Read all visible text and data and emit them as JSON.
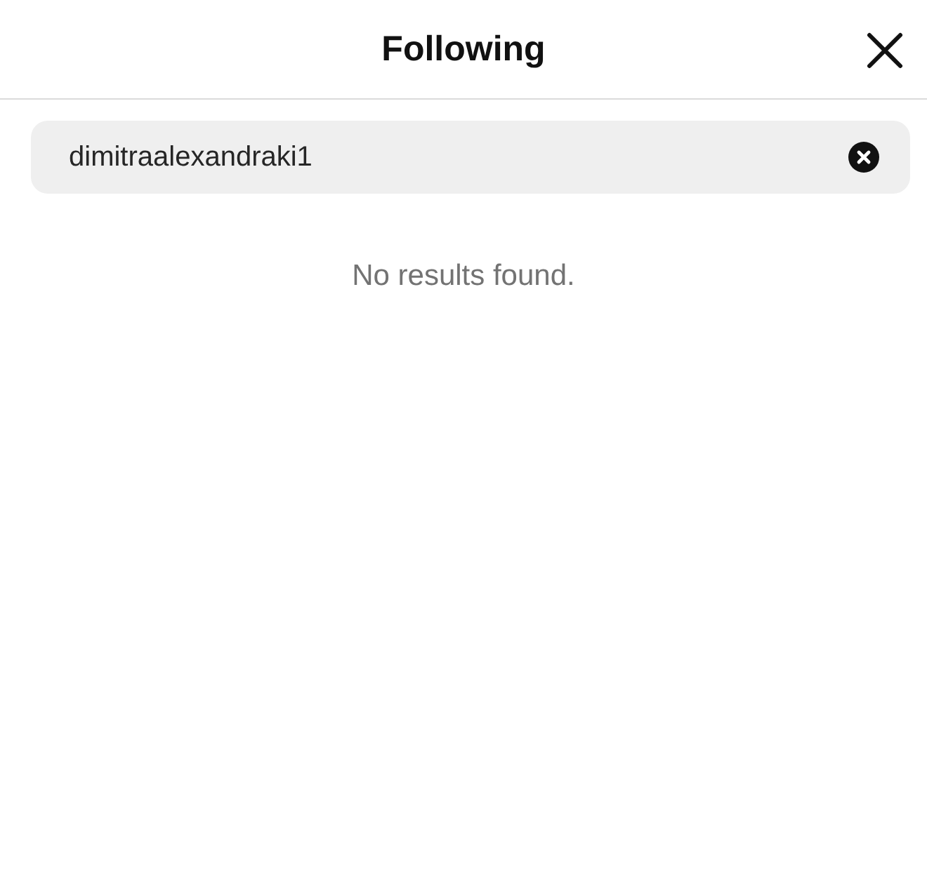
{
  "dialog": {
    "title": "Following"
  },
  "search": {
    "value": "dimitraalexandraki1"
  },
  "results": {
    "message": "No results found."
  }
}
